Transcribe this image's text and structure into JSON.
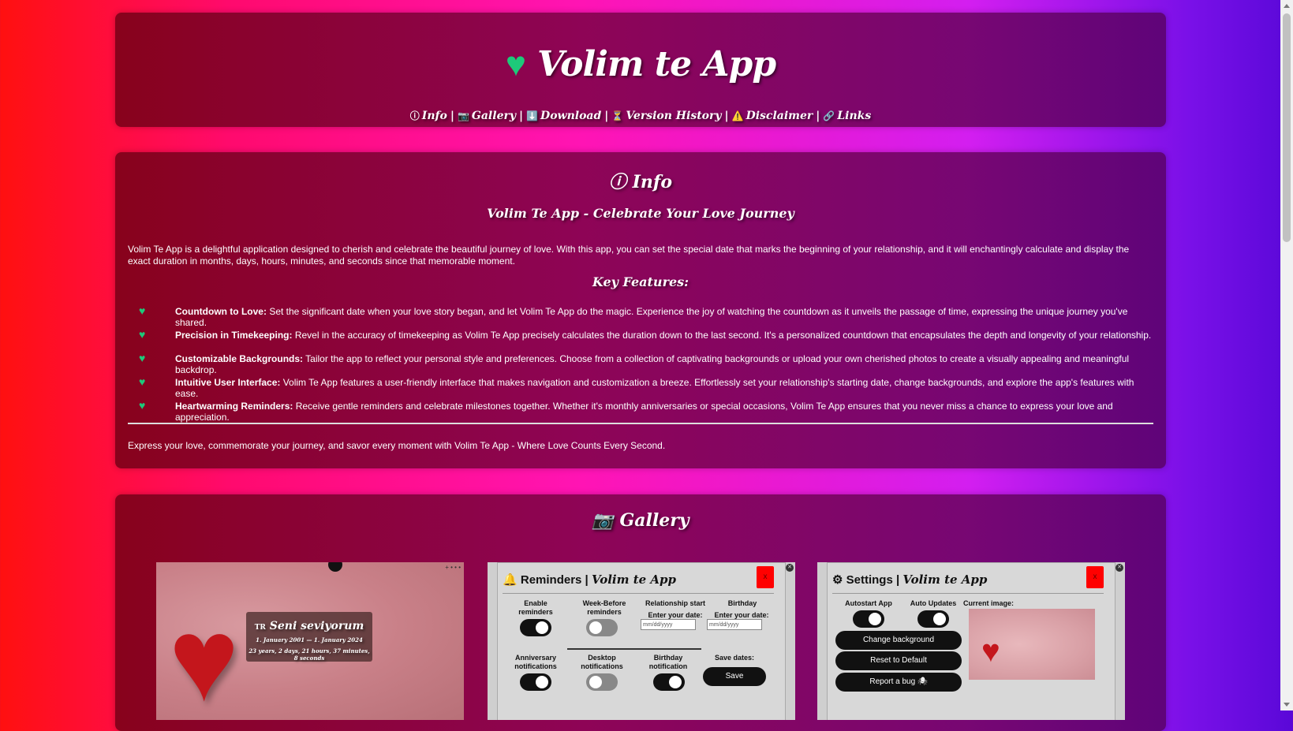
{
  "header": {
    "title": "Volim te App",
    "nav": [
      {
        "icon": "ⓘ",
        "label": "Info"
      },
      {
        "icon": "📷",
        "label": "Gallery"
      },
      {
        "icon": "⬇️",
        "label": "Download"
      },
      {
        "icon": "⏳",
        "label": "Version History"
      },
      {
        "icon": "⚠️",
        "label": "Disclaimer"
      },
      {
        "icon": "🔗",
        "label": "Links"
      }
    ]
  },
  "info": {
    "heading": "ⓘ Info",
    "subheading": "Volim Te App - Celebrate Your Love Journey",
    "intro": "Volim Te App is a delightful application designed to cherish and celebrate the beautiful journey of love. With this app, you can set the special date that marks the beginning of your relationship, and it will enchantingly calculate and display the exact duration in months, days, hours, minutes, and seconds since that memorable moment.",
    "features_heading": "Key Features:",
    "features": [
      {
        "title": "Countdown to Love:",
        "text": " Set the significant date when your love story began, and let Volim Te App do the magic. Experience the joy of watching the countdown as it unveils the passage of time, expressing the unique journey you've shared."
      },
      {
        "title": "Precision in Timekeeping:",
        "text": " Revel in the accuracy of timekeeping as Volim Te App precisely calculates the duration down to the last second. It's a personalized countdown that encapsulates the depth and longevity of your relationship."
      },
      {
        "title": "Customizable Backgrounds:",
        "text": " Tailor the app to reflect your personal style and preferences. Choose from a collection of captivating backgrounds or upload your own cherished photos to create a visually appealing and meaningful backdrop."
      },
      {
        "title": "Intuitive User Interface:",
        "text": " Volim Te App features a user-friendly interface that makes navigation and customization a breeze. Effortlessly set your relationship's starting date, change backgrounds, and explore the app's features with ease."
      },
      {
        "title": "Heartwarming Reminders:",
        "text": " Receive gentle reminders and celebrate milestones together. Whether it's monthly anniversaries or special occasions, Volim Te App ensures that you never miss a chance to express your love and appreciation."
      }
    ],
    "closing": "Express your love, commemorate your journey, and savor every moment with Volim Te App - Where Love Counts Every Second."
  },
  "gallery": {
    "heading": "📷 Gallery",
    "shot1": {
      "lang": "TR",
      "phrase": "Seni seviyorum",
      "dates": "1. January 2001 — 1. January 2024",
      "duration": "23 years, 2 days, 21 hours, 37 minutes, 8 seconds",
      "window_controls": "+ • • •"
    },
    "reminders": {
      "title": "Reminders |",
      "brand": "Volim te App",
      "close": "x",
      "enable_reminders": "Enable reminders",
      "week_before": "Week-Before reminders",
      "relationship_start": "Relationship start",
      "birthday": "Birthday",
      "enter_date": "Enter your date:",
      "date_placeholder": "mm/dd/yyyy",
      "anniversary": "Anniversary notifications",
      "desktop": "Desktop notifications",
      "birthday_notif": "Birthday notification",
      "save_dates": "Save dates:",
      "save": "Save",
      "toggles": {
        "enable": true,
        "week_before": false,
        "anniversary": true,
        "desktop": false,
        "birthday": true
      }
    },
    "settings": {
      "title": "Settings |",
      "brand": "Volim te App",
      "close": "x",
      "autostart": "Autostart App",
      "auto_updates": "Auto Updates",
      "current_image": "Current image:",
      "change_bg": "Change background",
      "reset": "Reset to Default",
      "report": "Report a bug 🕷",
      "toggles": {
        "autostart": true,
        "auto_updates": true
      }
    }
  },
  "colors": {
    "accent_heart": "#1ec97a",
    "close_red": "#ff0000"
  }
}
